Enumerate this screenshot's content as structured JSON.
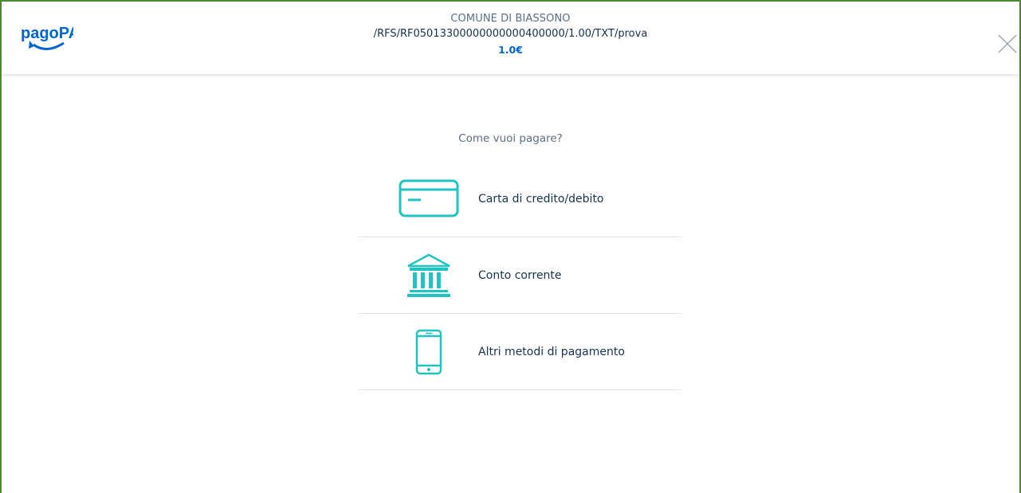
{
  "header": {
    "logo_text": "pagoPA",
    "org_name": "COMUNE DI BIASSONO",
    "reference": "/RFS/RF05013300000000000400000/1.00/TXT/prova",
    "amount": "1.0€"
  },
  "main": {
    "question": "Come vuoi pagare?",
    "methods": [
      {
        "label": "Carta di credito/debito",
        "icon": "credit-card-icon"
      },
      {
        "label": "Conto corrente",
        "icon": "bank-icon"
      },
      {
        "label": "Altri metodi di pagamento",
        "icon": "smartphone-icon"
      }
    ]
  },
  "colors": {
    "brand_blue": "#0066cc",
    "icon_teal": "#1fc4c0",
    "frame_green": "#4e8a34",
    "text_dark": "#17324d",
    "text_muted": "#5c6f82"
  }
}
